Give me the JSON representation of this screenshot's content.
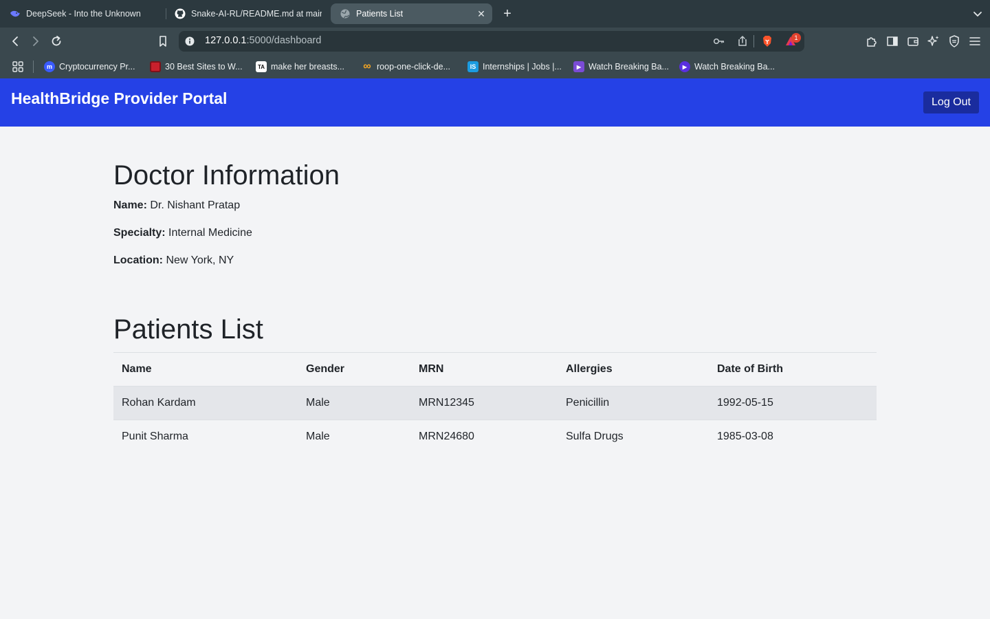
{
  "browser": {
    "tabs": [
      {
        "title": "DeepSeek - Into the Unknown",
        "icon": "deepseek-whale-icon"
      },
      {
        "title": "Snake-AI-RL/README.md at main",
        "icon": "github-icon"
      },
      {
        "title": "Patients List",
        "icon": "globe-icon",
        "active": true
      }
    ],
    "close_glyph": "✕",
    "new_tab_glyph": "+",
    "url_host": "127.0.0.1",
    "url_rest": ":5000/dashboard",
    "brave_badge": "1",
    "bookmarks": [
      {
        "label": "Cryptocurrency Pr...",
        "icon": "coinmarketcap-icon",
        "color": "#3a5bff",
        "glyph": "m"
      },
      {
        "label": "30 Best Sites to W...",
        "icon": "red-square-icon",
        "color": "#c8202c",
        "glyph": ""
      },
      {
        "label": "make her breasts...",
        "icon": "ta-icon",
        "color": "#ffffff",
        "glyph": "TA"
      },
      {
        "label": "roop-one-click-de...",
        "icon": "infinity-icon",
        "color": "#f5a623",
        "glyph": "∞"
      },
      {
        "label": "Internships | Jobs |...",
        "icon": "internshala-icon",
        "color": "#1b9be0",
        "glyph": "IS"
      },
      {
        "label": "Watch Breaking Ba...",
        "icon": "film-icon",
        "color": "#7a4bd6",
        "glyph": "▶"
      },
      {
        "label": "Watch Breaking Ba...",
        "icon": "play-circle-icon",
        "color": "#5a2fe0",
        "glyph": "▶"
      }
    ]
  },
  "app": {
    "title": "HealthBridge Provider Portal",
    "logout_label": "Log Out"
  },
  "doctor": {
    "heading": "Doctor Information",
    "name_label": "Name:",
    "name": "Dr. Nishant Pratap",
    "specialty_label": "Specialty:",
    "specialty": "Internal Medicine",
    "location_label": "Location:",
    "location": "New York, NY"
  },
  "patients": {
    "heading": "Patients List",
    "columns": [
      "Name",
      "Gender",
      "MRN",
      "Allergies",
      "Date of Birth"
    ],
    "rows": [
      [
        "Rohan Kardam",
        "Male",
        "MRN12345",
        "Penicillin",
        "1992-05-15"
      ],
      [
        "Punit Sharma",
        "Male",
        "MRN24680",
        "Sulfa Drugs",
        "1985-03-08"
      ]
    ]
  },
  "colors": {
    "header_bg": "#2541e6",
    "logout_bg": "#1a2c9e",
    "page_bg": "#f3f4f6",
    "stripe_bg": "#e4e6ea"
  }
}
